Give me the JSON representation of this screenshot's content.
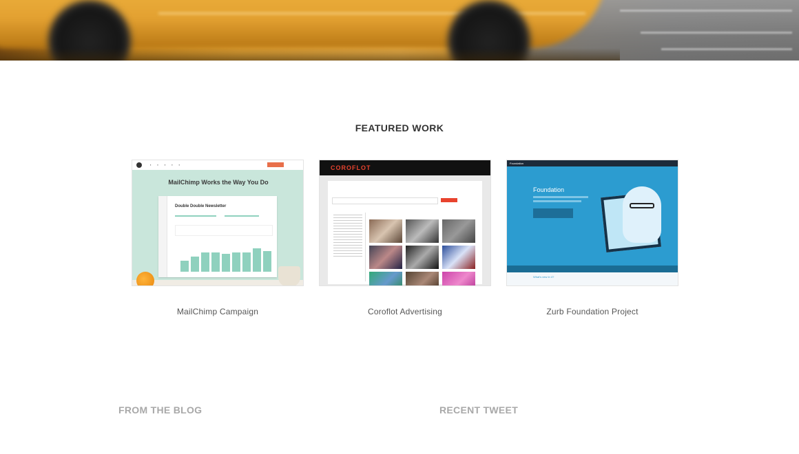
{
  "hero": {
    "image": "blurred-taxi-photo"
  },
  "featured": {
    "title": "FEATURED WORK",
    "items": [
      {
        "caption": "MailChimp Campaign",
        "thumb": {
          "headline": "MailChimp Works the Way You Do",
          "panel_title": "Double Double Newsletter"
        }
      },
      {
        "caption": "Coroflot Advertising",
        "thumb": {
          "brand": "COROFLOT"
        }
      },
      {
        "caption": "Zurb Foundation Project",
        "thumb": {
          "brand": "Foundation",
          "title": "Foundation",
          "footer": "What's new in 4?"
        }
      }
    ]
  },
  "lower": {
    "blog_title": "FROM THE BLOG",
    "tweet_title": "RECENT TWEET"
  }
}
